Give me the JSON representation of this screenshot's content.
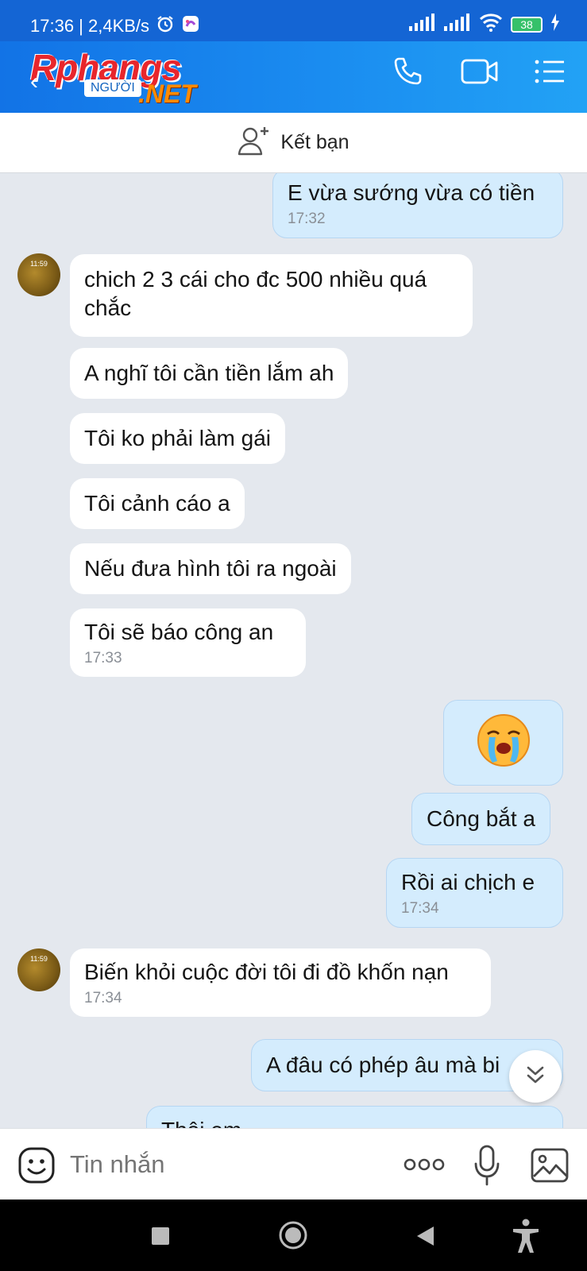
{
  "status_bar": {
    "time_speed": "17:36 | 2,4KB/s",
    "battery": "38"
  },
  "header": {
    "logo_text_main": "Rphangs",
    "logo_text_tag": "NGƯỜI",
    "logo_text_net": ".NET",
    "icons": [
      "back-arrow-icon",
      "phone-icon",
      "video-call-icon",
      "menu-list-icon"
    ]
  },
  "friend_bar": {
    "label": "Kết bạn",
    "icon": "add-friend-icon"
  },
  "messages": [
    {
      "dir": "out",
      "text": "E vừa sướng vừa có tiền",
      "time": "17:32"
    },
    {
      "dir": "in",
      "text": "chich 2 3 cái cho đc 500 nhiều quá chắc",
      "time": ""
    },
    {
      "dir": "in",
      "text": "A nghĩ tôi cần tiền lắm ah",
      "time": ""
    },
    {
      "dir": "in",
      "text": "Tôi ko phải làm gái",
      "time": ""
    },
    {
      "dir": "in",
      "text": "Tôi cảnh cáo a",
      "time": ""
    },
    {
      "dir": "in",
      "text": "Nếu đưa hình tôi ra ngoài",
      "time": ""
    },
    {
      "dir": "in",
      "text": "Tôi sẽ báo công an",
      "time": "17:33"
    },
    {
      "dir": "out",
      "text": "",
      "sticker": "crying-face-sticker",
      "time": ""
    },
    {
      "dir": "out",
      "text": "Công bắt a",
      "time": ""
    },
    {
      "dir": "out",
      "text": "Rồi ai chịch e",
      "time": "17:34"
    },
    {
      "dir": "in",
      "text": "Biến khỏi cuộc đời tôi đi đồ khốn nạn",
      "time": "17:34"
    },
    {
      "dir": "out",
      "text": "A đâu có phép âu mà bi",
      "time": ""
    },
    {
      "dir": "out",
      "text": "Thôi em ...",
      "time": ""
    }
  ],
  "avatar_time": "11:59",
  "input": {
    "placeholder": "Tin nhắn",
    "icons": [
      "emoji-icon",
      "more-options-icon",
      "microphone-icon",
      "image-icon"
    ]
  },
  "nav": {
    "icons": [
      "recent-apps-icon",
      "home-icon",
      "back-icon",
      "accessibility-icon"
    ]
  },
  "colors": {
    "header_blue": "#1a8cf0",
    "outgoing_bubble": "#d4ecfd",
    "incoming_bubble": "#ffffff",
    "chat_bg": "#e4e8ee"
  }
}
